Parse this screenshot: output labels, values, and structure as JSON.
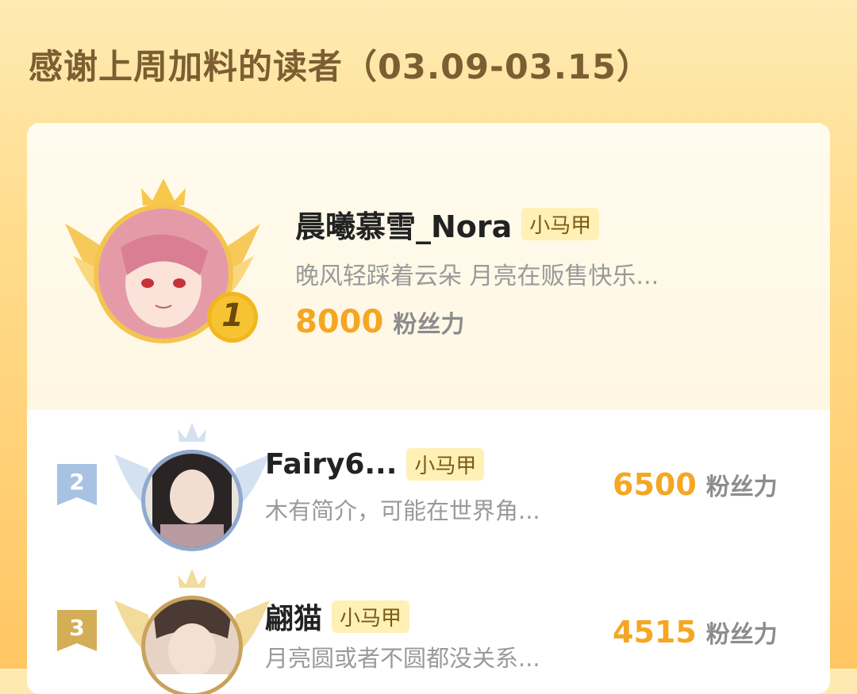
{
  "header": {
    "title": "感谢上周加料的读者（03.09-03.15）"
  },
  "colors": {
    "accent": "#F5A623",
    "silver": "#9DB8D8",
    "bronze": "#D4AE57"
  },
  "leaderboard": [
    {
      "rank": "1",
      "name": "晨曦慕雪_Nora",
      "badge": "小马甲",
      "bio": "晚风轻踩着云朵 月亮在贩售快乐...",
      "power": "8000",
      "power_label": "粉丝力"
    },
    {
      "rank": "2",
      "name": "Fairy6...",
      "badge": "小马甲",
      "bio": "木有简介，可能在世界角...",
      "power": "6500",
      "power_label": "粉丝力"
    },
    {
      "rank": "3",
      "name": "翩猫",
      "badge": "小马甲",
      "bio": "月亮圆或者不圆都没关系...",
      "power": "4515",
      "power_label": "粉丝力"
    }
  ]
}
